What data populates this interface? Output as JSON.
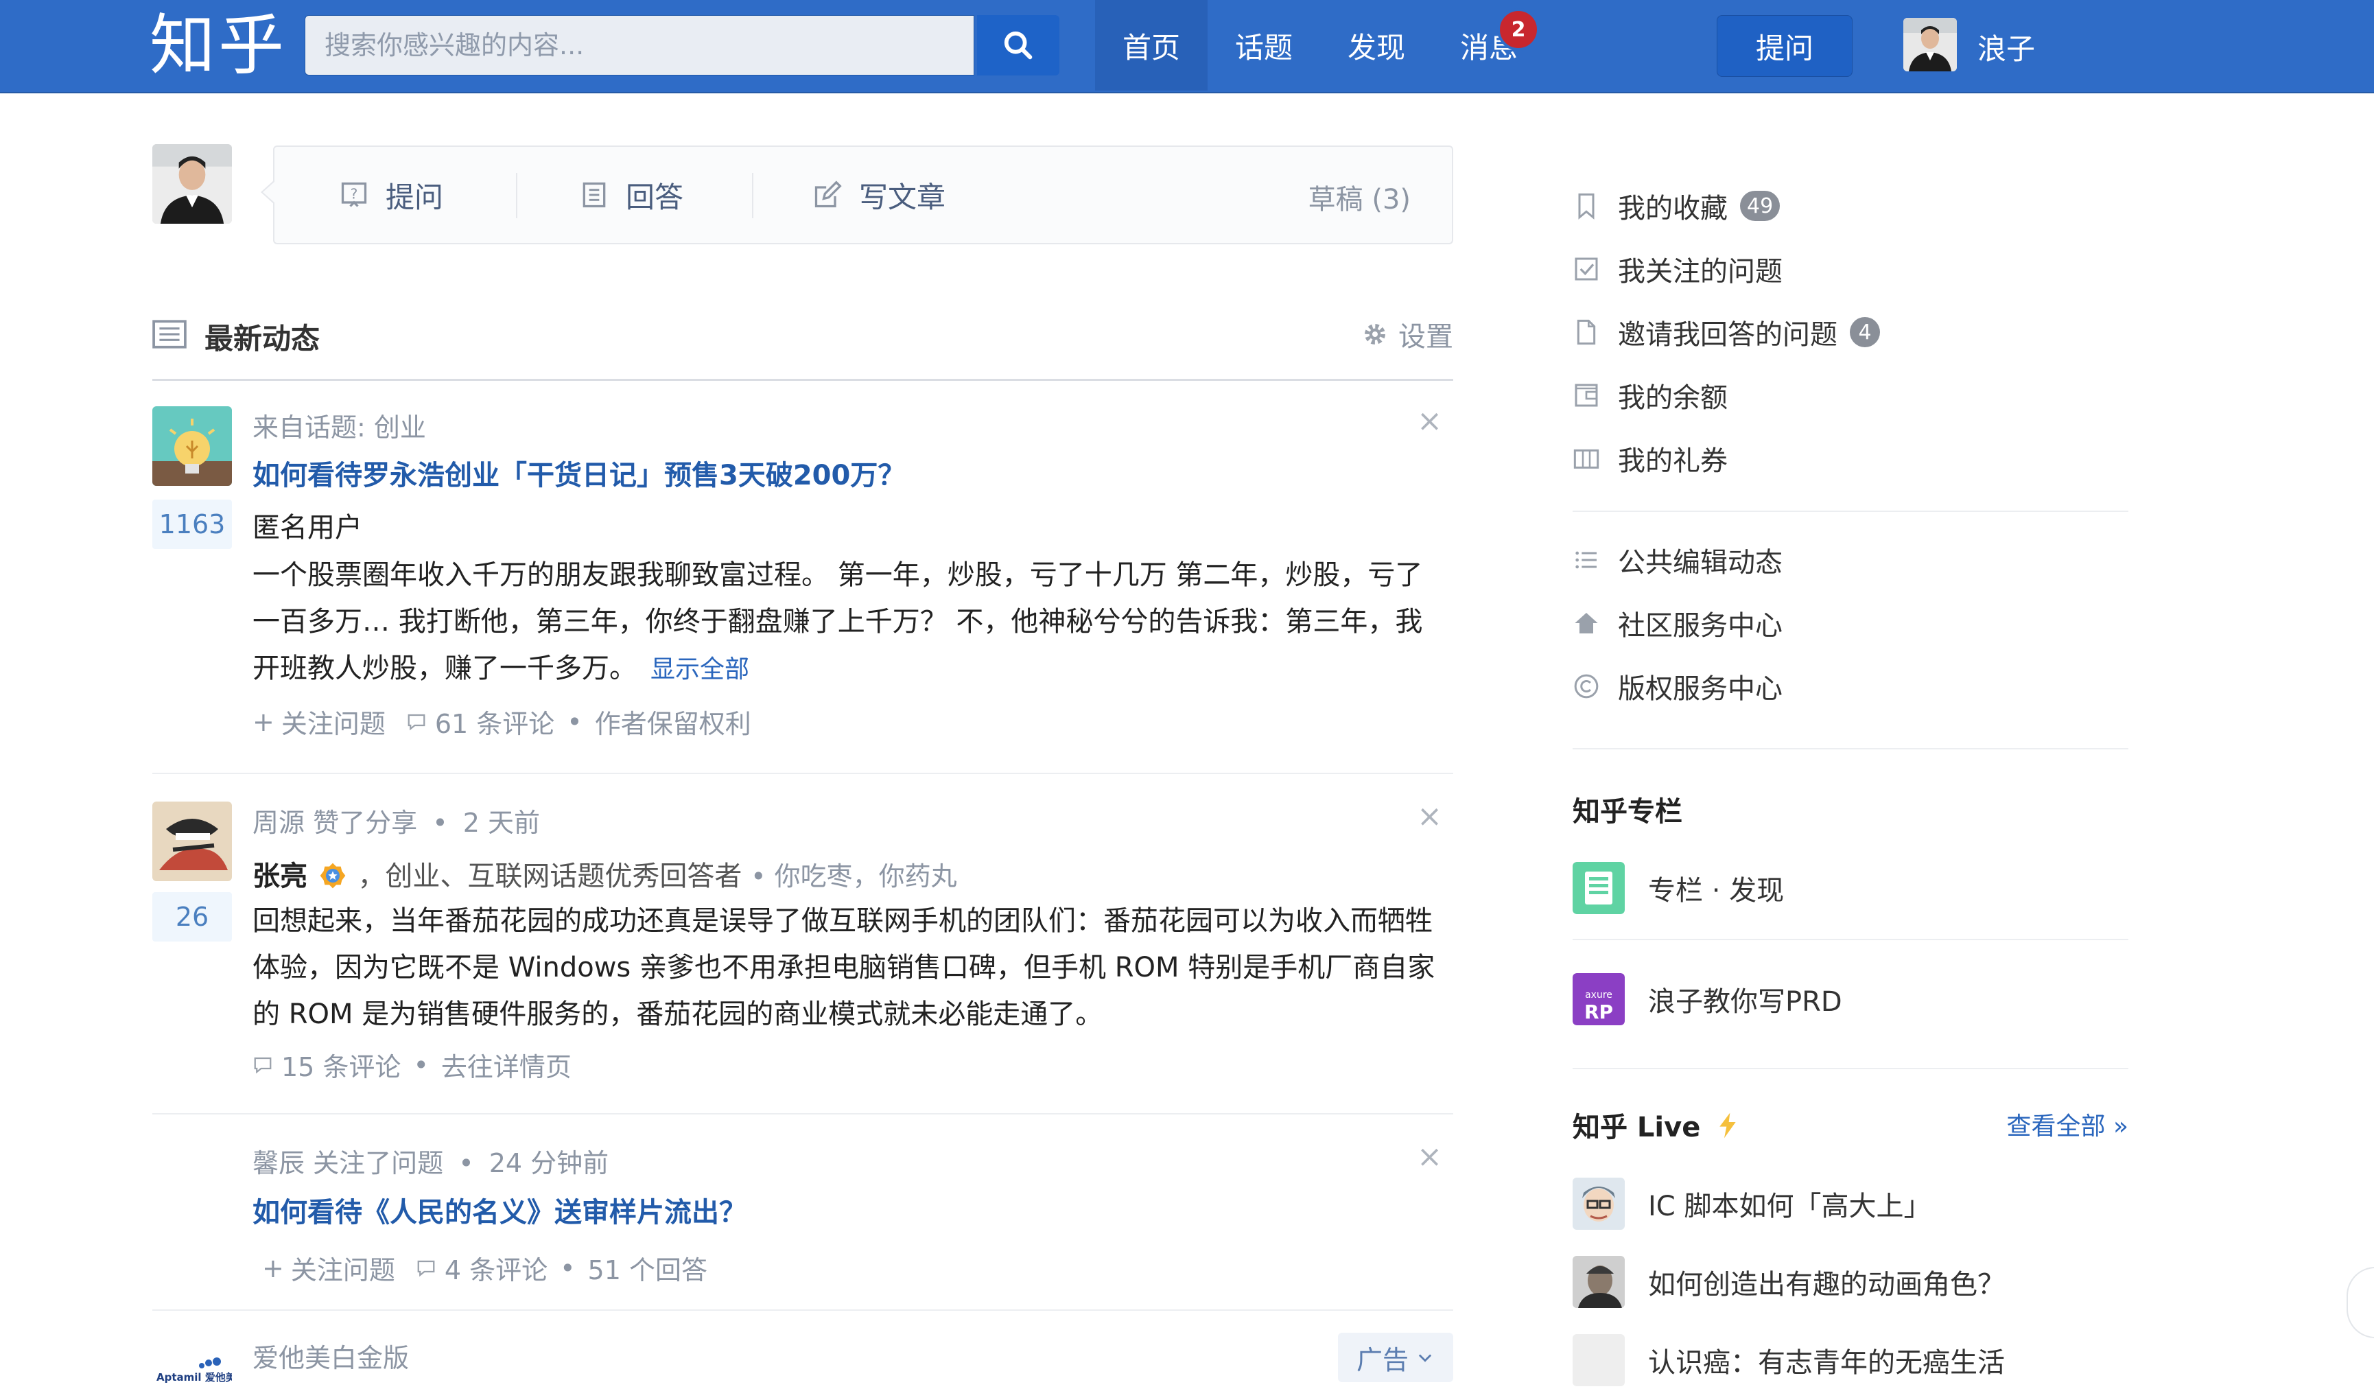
{
  "header": {
    "logo": "知乎",
    "search_placeholder": "搜索你感兴趣的内容...",
    "nav": [
      {
        "label": "首页",
        "active": true
      },
      {
        "label": "话题"
      },
      {
        "label": "发现"
      },
      {
        "label": "消息",
        "badge": "2"
      }
    ],
    "ask_label": "提问",
    "user_name": "浪子"
  },
  "composer": {
    "ask": "提问",
    "answer": "回答",
    "write": "写文章",
    "drafts": "草稿 (3)"
  },
  "feed": {
    "title": "最新动态",
    "settings": "设置",
    "items": [
      {
        "meta": "来自话题: 创业",
        "title": "如何看待罗永浩创业「干货日记」预售3天破200万？",
        "votes": "1163",
        "author": "匿名用户",
        "body": "一个股票圈年收入千万的朋友跟我聊致富过程。 第一年，炒股，亏了十几万 第二年，炒股，亏了一百多万… 我打断他，第三年，你终于翻盘赚了上千万？ 不，他神秘兮兮的告诉我：第三年，我开班教人炒股，赚了一千多万。",
        "show_all": "显示全部",
        "follow": "关注问题",
        "comments": "61 条评论",
        "rights": "作者保留权利"
      },
      {
        "meta_actor": "周源 赞了分享",
        "meta_time": "2 天前",
        "votes": "26",
        "author": "张亮",
        "author_bio": "，创业、互联网话题优秀回答者",
        "author_motto": "你吃枣，你药丸",
        "body": "回想起来，当年番茄花园的成功还真是误导了做互联网手机的团队们：番茄花园可以为收入而牺牲体验，因为它既不是 Windows 亲爹也不用承担电脑销售口碑，但手机 ROM 特别是手机厂商自家的 ROM 是为销售硬件服务的，番茄花园的商业模式就未必能走通了。",
        "comments": "15 条评论",
        "detail": "去往详情页"
      },
      {
        "meta_actor": "馨辰 关注了问题",
        "meta_time": "24 分钟前",
        "title": "如何看待《人民的名义》送审样片流出？",
        "follow": "关注问题",
        "comments": "4 条评论",
        "answers": "51 个回答"
      },
      {
        "meta": "爱他美白金版",
        "ad_label": "广告",
        "brand": "Aptamil 爱他美"
      }
    ]
  },
  "sidebar": {
    "personal": [
      {
        "label": "我的收藏",
        "count": "49"
      },
      {
        "label": "我关注的问题"
      },
      {
        "label": "邀请我回答的问题",
        "count": "4"
      },
      {
        "label": "我的余额"
      },
      {
        "label": "我的礼券"
      }
    ],
    "services": [
      {
        "label": "公共编辑动态"
      },
      {
        "label": "社区服务中心"
      },
      {
        "label": "版权服务中心"
      }
    ],
    "columns_title": "知乎专栏",
    "columns": [
      {
        "label": "专栏 · 发现"
      },
      {
        "label": "浪子教你写PRD",
        "icon_text_top": "axure",
        "icon_text_main": "RP"
      }
    ],
    "live_title": "知乎 Live",
    "live_more": "查看全部 »",
    "live": [
      {
        "label": "IC 脚本如何「高大上」"
      },
      {
        "label": "如何创造出有趣的动画角色？"
      },
      {
        "label": "认识癌：有志青年的无癌生活"
      }
    ]
  }
}
